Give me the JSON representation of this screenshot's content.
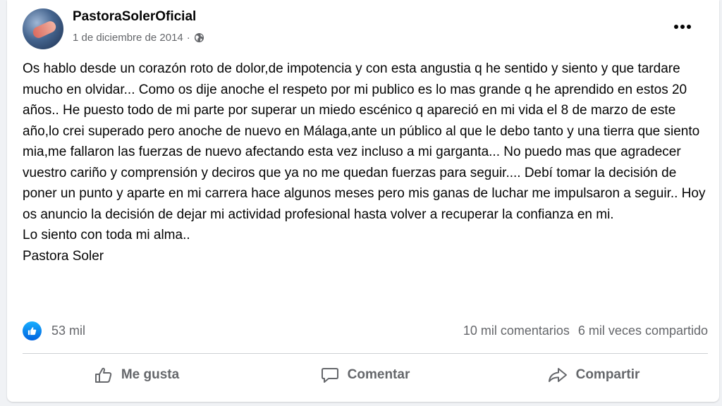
{
  "post": {
    "author": "PastoraSolerOficial",
    "date": "1 de diciembre de 2014",
    "separator": "·",
    "privacy_icon": "globe-icon",
    "paragraphs": [
      "Os hablo desde un corazón roto de dolor,de impotencia y con esta angustia q he sentido y siento y que tardare mucho en olvidar... Como os dije anoche el respeto por mi publico es lo mas grande q he aprendido en estos 20 años.. He puesto todo de mi parte por superar un miedo escénico q apareció en mi vida el 8 de marzo de este año,lo crei superado pero anoche de nuevo en Málaga,ante un público al que le debo tanto y una tierra que siento mia,me fallaron las fuerzas de nuevo afectando esta vez incluso a mi garganta... No puedo mas que agradecer vuestro cariño y comprensión y deciros que ya no me quedan fuerzas para seguir.... Debí tomar la decisión de poner un punto y aparte en mi carrera hace algunos meses pero mis ganas de luchar me impulsaron a seguir.. Hoy os anuncio la decisión de dejar mi actividad profesional hasta volver a recuperar la confianza en mi.",
      "Lo siento con toda mi alma..",
      "Pastora Soler"
    ]
  },
  "stats": {
    "likes": "53 mil",
    "comments": "10 mil comentarios",
    "shares": "6 mil veces compartido"
  },
  "actions": {
    "like": "Me gusta",
    "comment": "Comentar",
    "share": "Compartir"
  },
  "colors": {
    "background": "#f0f2f5",
    "card": "#ffffff",
    "text": "#050505",
    "secondary": "#65676b",
    "like_blue": "#0866ff"
  }
}
